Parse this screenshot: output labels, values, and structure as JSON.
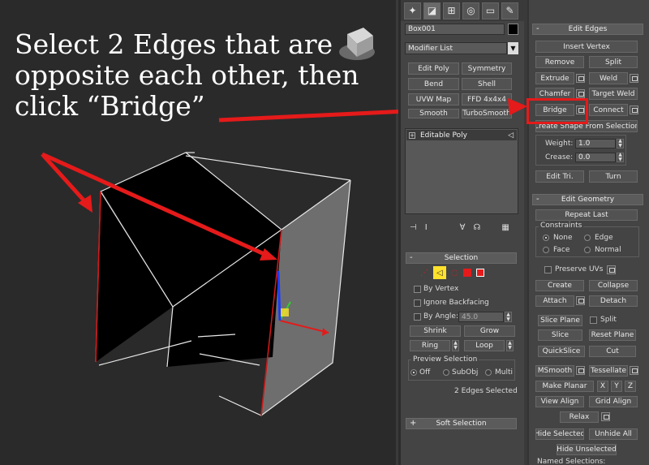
{
  "caption": {
    "line1": "Select 2 Edges that are",
    "line2": "opposite each other, then",
    "line3": "click “Bridge”"
  },
  "command_panel": {
    "tabs": [
      "create-icon",
      "modify-icon",
      "hierarchy-icon",
      "motion-icon",
      "display-icon",
      "utilities-icon"
    ],
    "object_name": "Box001",
    "modifier_list": "Modifier List",
    "modifier_buttons": [
      "Edit Poly",
      "Symmetry",
      "Bend",
      "Shell",
      "UVW Map",
      "FFD 4x4x4",
      "Smooth",
      "TurboSmooth"
    ],
    "stack_item": "Editable Poly"
  },
  "selection": {
    "header": "Selection",
    "by_vertex": "By Vertex",
    "ignore_backfacing": "Ignore Backfacing",
    "by_angle": "By Angle:",
    "angle_value": "45.0",
    "shrink": "Shrink",
    "grow": "Grow",
    "ring": "Ring",
    "loop": "Loop",
    "preview_selection": "Preview Selection",
    "preview_off": "Off",
    "preview_subobj": "SubObj",
    "preview_multi": "Multi",
    "status": "2 Edges Selected",
    "soft_selection": "Soft Selection"
  },
  "edit_edges": {
    "header": "Edit Edges",
    "insert_vertex": "Insert Vertex",
    "remove": "Remove",
    "split": "Split",
    "extrude": "Extrude",
    "weld": "Weld",
    "chamfer": "Chamfer",
    "target_weld": "Target Weld",
    "bridge": "Bridge",
    "connect": "Connect",
    "create_shape": "Create Shape From Selection",
    "weight_label": "Weight:",
    "weight_value": "1.0",
    "crease_label": "Crease:",
    "crease_value": "0.0",
    "edit_tri": "Edit Tri.",
    "turn": "Turn"
  },
  "edit_geometry": {
    "header": "Edit Geometry",
    "repeat_last": "Repeat Last",
    "constraints": "Constraints",
    "none": "None",
    "edge": "Edge",
    "face": "Face",
    "normal": "Normal",
    "preserve_uvs": "Preserve UVs",
    "create": "Create",
    "collapse": "Collapse",
    "attach": "Attach",
    "detach": "Detach",
    "slice_plane": "Slice Plane",
    "split": "Split",
    "slice": "Slice",
    "reset_plane": "Reset Plane",
    "quickslice": "QuickSlice",
    "cut": "Cut",
    "msmooth": "MSmooth",
    "tessellate": "Tessellate",
    "make_planar": "Make Planar",
    "x": "X",
    "y": "Y",
    "z": "Z",
    "view_align": "View Align",
    "grid_align": "Grid Align",
    "relax": "Relax",
    "hide_selected": "Hide Selected",
    "unhide_all": "Unhide All",
    "hide_unselected": "Hide Unselected",
    "named_selections": "Named Selections:"
  },
  "colors": {
    "annotation_red": "#e51a1a",
    "selection_yellow": "#ffe22b",
    "panel_bg": "#444444",
    "viewport_bg": "#2a2a2a"
  }
}
